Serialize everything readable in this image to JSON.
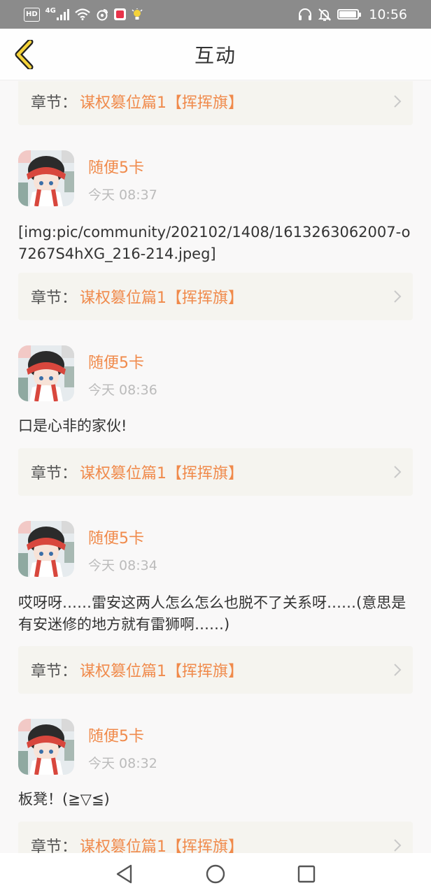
{
  "status_bar": {
    "hd": "HD",
    "network": "4G",
    "time": "10:56",
    "battery_level": 0.95
  },
  "header": {
    "title": "互动"
  },
  "chapter_prefix": "章节：",
  "chapter_name": "谋权篡位篇1【挥挥旗】",
  "posts": [
    {
      "username": "随便5卡",
      "time": "今天 08:37",
      "text": "[img:pic/community/202102/1408/1613263062007-o7267S4hXG_216-214.jpeg]"
    },
    {
      "username": "随便5卡",
      "time": "今天 08:36",
      "text": "口是心非的家伙!"
    },
    {
      "username": "随便5卡",
      "time": "今天 08:34",
      "text": "哎呀呀……雷安这两人怎么怎么也脱不了关系呀……(意思是有安迷修的地方就有雷狮啊……)"
    },
    {
      "username": "随便5卡",
      "time": "今天 08:32",
      "text": "板凳！(≧▽≦)"
    }
  ],
  "colors": {
    "accent": "#f08a4b",
    "back_arrow_fill": "#f5d33a",
    "status_bar": "#8b8b8b",
    "chapter_bg": "#f5f4ef"
  },
  "icons": {
    "back": "back-arrow-icon",
    "chapter_arrow": "chevron-right-icon",
    "nav_back": "triangle-back-icon",
    "nav_home": "circle-home-icon",
    "nav_recents": "square-recents-icon"
  }
}
